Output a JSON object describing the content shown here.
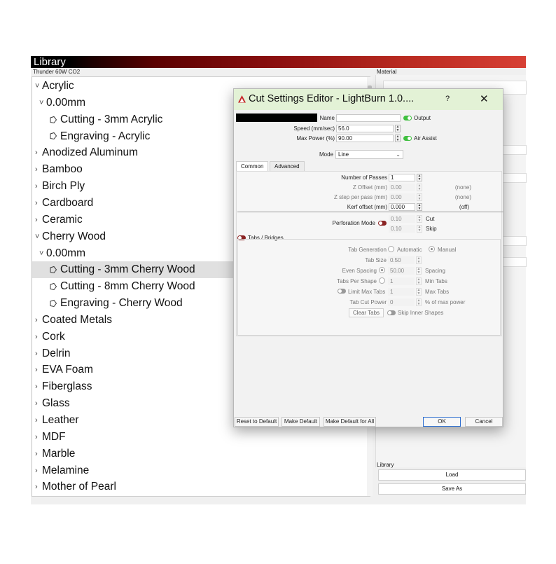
{
  "library": {
    "title": "Library",
    "machine": "Thunder 60W CO2",
    "material_label": "Material",
    "tree": [
      {
        "label": "Acrylic",
        "level": 0,
        "expanded": true
      },
      {
        "label": "0.00mm",
        "level": 1,
        "expanded": true
      },
      {
        "label": "Cutting - 3mm Acrylic",
        "level": 2,
        "leaf": true
      },
      {
        "label": "Engraving - Acrylic",
        "level": 2,
        "leaf": true
      },
      {
        "label": "Anodized Aluminum",
        "level": 0
      },
      {
        "label": "Bamboo",
        "level": 0
      },
      {
        "label": "Birch Ply",
        "level": 0
      },
      {
        "label": "Cardboard",
        "level": 0
      },
      {
        "label": "Ceramic",
        "level": 0
      },
      {
        "label": "Cherry Wood",
        "level": 0,
        "expanded": true
      },
      {
        "label": "0.00mm",
        "level": 1,
        "expanded": true
      },
      {
        "label": "Cutting - 3mm Cherry Wood",
        "level": 2,
        "leaf": true,
        "selected": true
      },
      {
        "label": "Cutting - 8mm Cherry Wood",
        "level": 2,
        "leaf": true
      },
      {
        "label": "Engraving - Cherry Wood",
        "level": 2,
        "leaf": true
      },
      {
        "label": "Coated Metals",
        "level": 0
      },
      {
        "label": "Cork",
        "level": 0
      },
      {
        "label": "Delrin",
        "level": 0
      },
      {
        "label": "EVA Foam",
        "level": 0
      },
      {
        "label": "Fiberglass",
        "level": 0
      },
      {
        "label": "Glass",
        "level": 0
      },
      {
        "label": "Leather",
        "level": 0
      },
      {
        "label": "MDF",
        "level": 0
      },
      {
        "label": "Marble",
        "level": 0
      },
      {
        "label": "Melamine",
        "level": 0
      },
      {
        "label": "Mother of Pearl",
        "level": 0
      }
    ],
    "bottom_label": "Library",
    "load_label": "Load",
    "save_as_label": "Save As"
  },
  "dialog": {
    "title": "Cut Settings Editor - LightBurn 1.0....",
    "help": "?",
    "close": "✕",
    "name_label": "Name",
    "name_value": "",
    "output_label": "Output",
    "speed_label": "Speed (mm/sec)",
    "speed_value": "56.0",
    "max_power_label": "Max Power (%)",
    "max_power_value": "90.00",
    "air_assist_label": "Air Assist",
    "mode_label": "Mode",
    "mode_value": "Line",
    "tabs": [
      "Common",
      "Advanced"
    ],
    "passes_label": "Number of Passes",
    "passes_value": "1",
    "z_offset_label": "Z Offset (mm)",
    "z_offset_value": "0.00",
    "z_offset_note": "(none)",
    "z_step_label": "Z step per pass (mm)",
    "z_step_value": "0.00",
    "z_step_note": "(none)",
    "kerf_label": "Kerf offset (mm)",
    "kerf_value": "0.000",
    "kerf_note": "(off)",
    "perforation_label": "Perforation Mode",
    "perf_cut_value": "0.10",
    "perf_cut_label": "Cut",
    "perf_skip_value": "0.10",
    "perf_skip_label": "Skip",
    "tabs_bridges_label": "Tabs / Bridges",
    "tab_generation_label": "Tab Generation",
    "automatic_label": "Automatic",
    "manual_label": "Manual",
    "tab_size_label": "Tab Size",
    "tab_size_value": "0.50",
    "even_spacing_label": "Even Spacing",
    "spacing_value": "50.00",
    "spacing_label": "Spacing",
    "tabs_per_shape_label": "Tabs Per Shape",
    "min_tabs_value": "1",
    "min_tabs_label": "Min Tabs",
    "limit_max_tabs_label": "Limit Max Tabs",
    "max_tabs_value": "1",
    "max_tabs_label": "Max Tabs",
    "tab_cut_power_label": "Tab Cut Power",
    "tab_cut_power_value": "0",
    "tab_cut_power_unit": "% of max power",
    "clear_tabs_label": "Clear Tabs",
    "skip_inner_label": "Skip Inner Shapes",
    "reset_label": "Reset to Default",
    "make_default_label": "Make Default",
    "make_default_all_label": "Make Default for All",
    "ok_label": "OK",
    "cancel_label": "Cancel"
  },
  "colors": {
    "titlebar": "#e3f2d6",
    "toggle_on": "#3fbf3f",
    "toggle_red": "#8a2323"
  }
}
